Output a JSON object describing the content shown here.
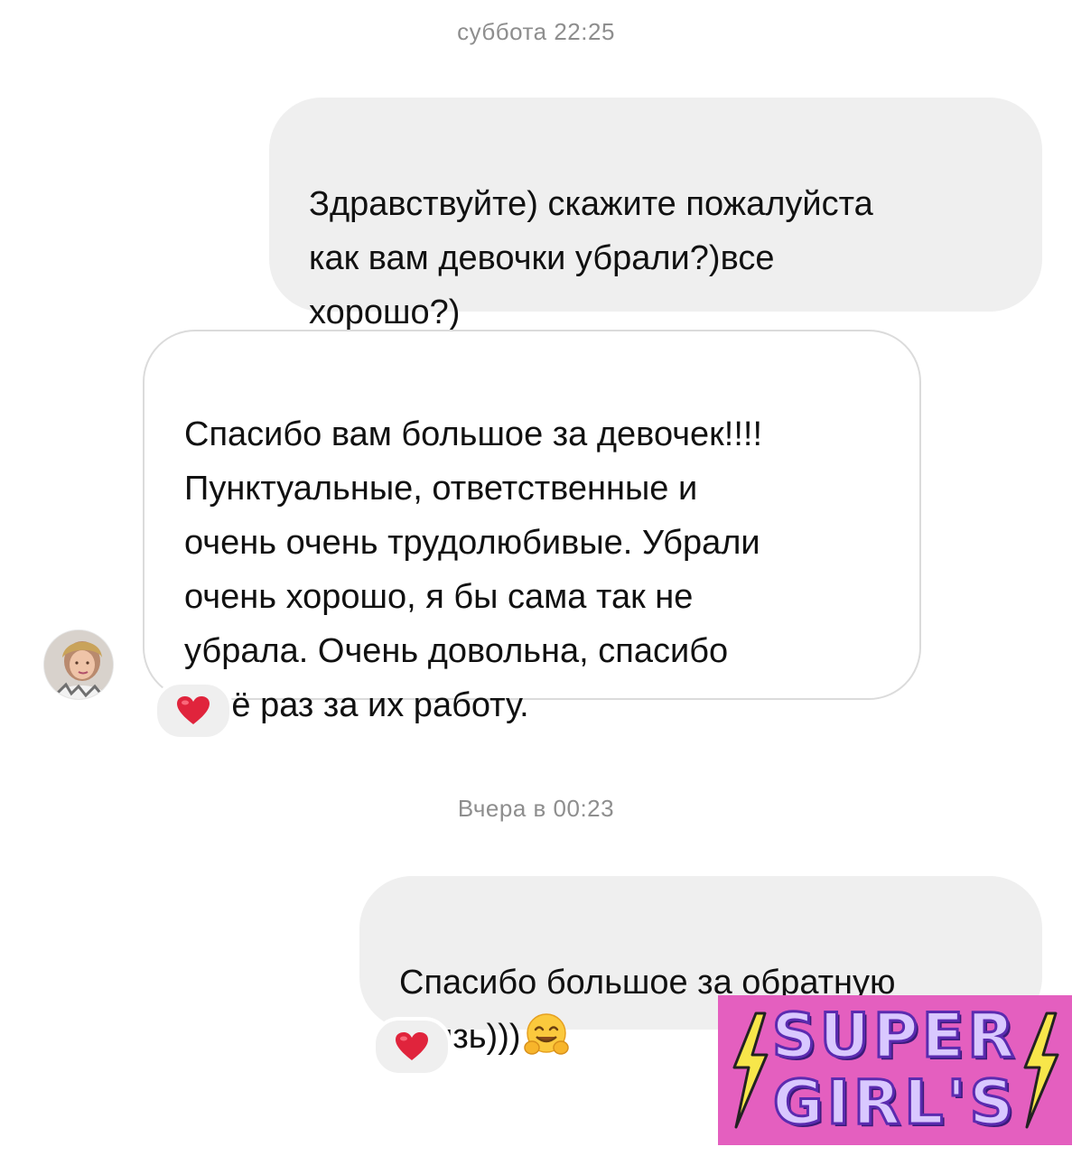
{
  "timestamps": {
    "first": "суббота 22:25",
    "second": "Вчера в 00:23"
  },
  "messages": [
    {
      "direction": "outgoing",
      "text": "Здравствуйте) скажите пожалуйста\nкак вам девочки убрали?)все\nхорошо?)"
    },
    {
      "direction": "incoming",
      "text": "Спасибо вам большое за девочек!!!!\nПунктуальные, ответственные и\nочень очень трудолюбивые. Убрали\nочень хорошо, я бы сама так не\nубрала. Очень довольна, спасибо\nещё раз за их работу.",
      "reaction": "heart-icon"
    },
    {
      "direction": "outgoing",
      "text": "Спасибо большое за обратную\nсвязь)))",
      "emoji": "hugging-face-emoji",
      "reaction": "heart-icon"
    }
  ],
  "logo": {
    "line1": "SUPER",
    "line2": "GIRL'S",
    "background_color": "#e45fbf",
    "text_color": "#d9c8ff",
    "bolt_color": "#f7e64a"
  },
  "colors": {
    "outgoing_bubble": "#efefef",
    "incoming_border": "#dbdbdb",
    "timestamp": "#8e8e8e",
    "reaction_heart": "#e0243c"
  }
}
